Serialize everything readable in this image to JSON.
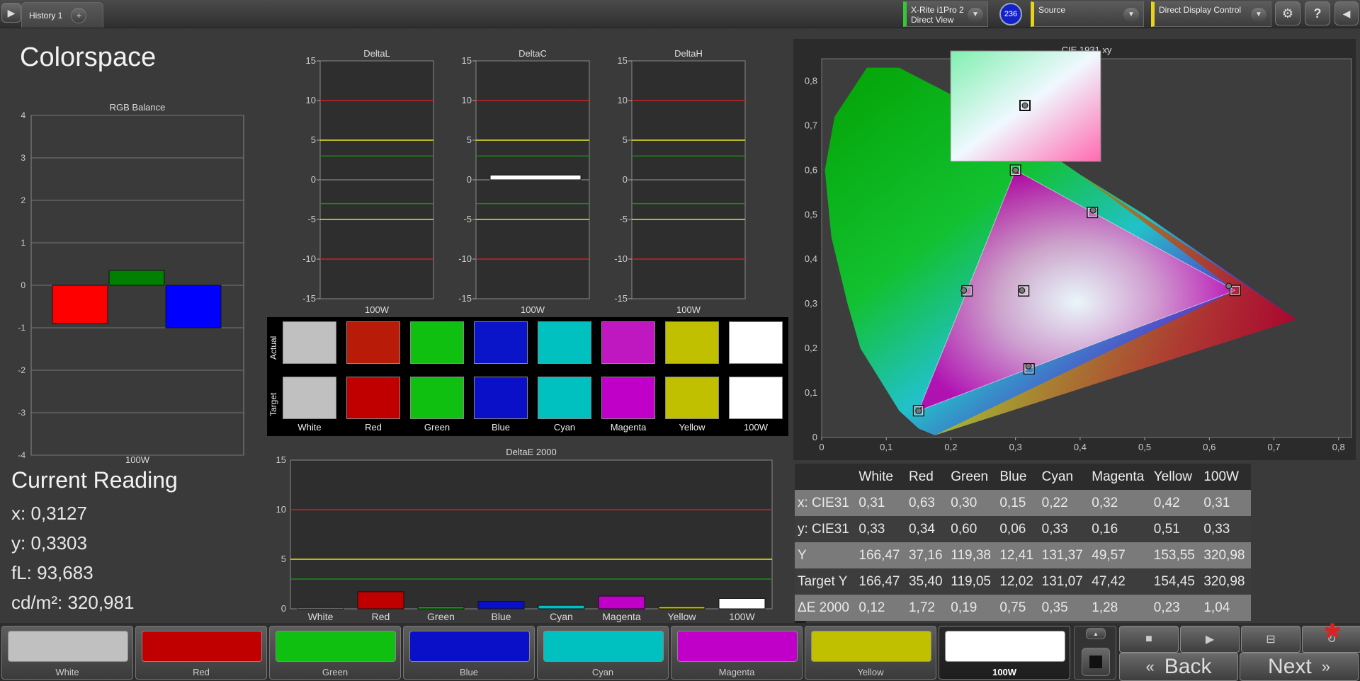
{
  "topbar": {
    "tab_label": "History 1",
    "add_tab": "+",
    "meter_line1": "X-Rite i1Pro 2",
    "meter_line2": "Direct View",
    "meter_badge": "236",
    "source_label": "Source",
    "ddc_label": "Direct Display Control",
    "help_icon_text": "?",
    "colors": {
      "meter": "#39c53a",
      "source": "#e8d31a"
    }
  },
  "page_title": "Colorspace",
  "rgb_balance": {
    "title": "RGB Balance",
    "xlabel": "100W",
    "yticks": [
      "4",
      "3",
      "2",
      "1",
      "0",
      "-1",
      "-2",
      "-3",
      "-4"
    ]
  },
  "delta_charts": [
    {
      "title": "DeltaL",
      "xlabel": "100W"
    },
    {
      "title": "DeltaC",
      "xlabel": "100W"
    },
    {
      "title": "DeltaH",
      "xlabel": "100W"
    }
  ],
  "delta_yticks": [
    "15",
    "10",
    "5",
    "0",
    "-5",
    "-10",
    "-15"
  ],
  "swatches": {
    "actual_label": "Actual",
    "target_label": "Target",
    "names": [
      "White",
      "Red",
      "Green",
      "Blue",
      "Cyan",
      "Magenta",
      "Yellow",
      "100W"
    ],
    "actual_colors": [
      "#c0c0c0",
      "#b81c08",
      "#10c010",
      "#0a14c8",
      "#00c0c0",
      "#c018c0",
      "#c0c000",
      "#ffffff"
    ],
    "target_colors": [
      "#c0c0c0",
      "#c00000",
      "#10c010",
      "#0a10c8",
      "#00c0c0",
      "#c000c8",
      "#c0c000",
      "#ffffff"
    ]
  },
  "deltae": {
    "title": "DeltaE 2000",
    "yticks": [
      "15",
      "10",
      "5",
      "0"
    ],
    "categories": [
      "White",
      "Red",
      "Green",
      "Blue",
      "Cyan",
      "Magenta",
      "Yellow",
      "100W"
    ]
  },
  "cie": {
    "title": "CIE 1931 xy",
    "xticks": [
      "0",
      "0,1",
      "0,2",
      "0,3",
      "0,4",
      "0,5",
      "0,6",
      "0,7",
      "0,8"
    ],
    "yticks": [
      "0,8",
      "0,7",
      "0,6",
      "0,5",
      "0,4",
      "0,3",
      "0,2",
      "0,1",
      "0"
    ]
  },
  "current_reading": {
    "title": "Current Reading",
    "x": "x: 0,3127",
    "y": "y: 0,3303",
    "fl": "fL: 93,683",
    "cdm2": "cd/m²: 320,981"
  },
  "table": {
    "headers": [
      "",
      "White",
      "Red",
      "Green",
      "Blue",
      "Cyan",
      "Magenta",
      "Yellow",
      "100W"
    ],
    "rows": [
      [
        "x: CIE31",
        "0,31",
        "0,63",
        "0,30",
        "0,15",
        "0,22",
        "0,32",
        "0,42",
        "0,31"
      ],
      [
        "y: CIE31",
        "0,33",
        "0,34",
        "0,60",
        "0,06",
        "0,33",
        "0,16",
        "0,51",
        "0,33"
      ],
      [
        "Y",
        "166,47",
        "37,16",
        "119,38",
        "12,41",
        "131,37",
        "49,57",
        "153,55",
        "320,98"
      ],
      [
        "Target Y",
        "166,47",
        "35,40",
        "119,05",
        "12,02",
        "131,07",
        "47,42",
        "154,45",
        "320,98"
      ],
      [
        "ΔE 2000",
        "0,12",
        "1,72",
        "0,19",
        "0,75",
        "0,35",
        "1,28",
        "0,23",
        "1,04"
      ]
    ]
  },
  "bottom": {
    "tiles": [
      {
        "label": "White",
        "color": "#c0c0c0"
      },
      {
        "label": "Red",
        "color": "#c00000"
      },
      {
        "label": "Green",
        "color": "#10c010"
      },
      {
        "label": "Blue",
        "color": "#0a10c8"
      },
      {
        "label": "Cyan",
        "color": "#00c0c0"
      },
      {
        "label": "Magenta",
        "color": "#c000c8"
      },
      {
        "label": "Yellow",
        "color": "#c0c000"
      },
      {
        "label": "100W",
        "color": "#ffffff"
      }
    ],
    "back_label": "Back",
    "next_label": "Next",
    "asterisk": "*"
  },
  "chart_data": [
    {
      "type": "bar",
      "title": "RGB Balance",
      "categories": [
        "100W"
      ],
      "series": [
        {
          "name": "Red",
          "values": [
            -0.9
          ],
          "color": "#ff0000"
        },
        {
          "name": "Green",
          "values": [
            0.35
          ],
          "color": "#008000"
        },
        {
          "name": "Blue",
          "values": [
            -1.0
          ],
          "color": "#0000ff"
        }
      ],
      "ylim": [
        -4,
        4
      ]
    },
    {
      "type": "bar",
      "title": "DeltaL",
      "categories": [
        "100W"
      ],
      "values": [
        0
      ],
      "ylim": [
        -15,
        15
      ]
    },
    {
      "type": "bar",
      "title": "DeltaC",
      "categories": [
        "100W"
      ],
      "values": [
        0.6
      ],
      "ylim": [
        -15,
        15
      ]
    },
    {
      "type": "bar",
      "title": "DeltaH",
      "categories": [
        "100W"
      ],
      "values": [
        0
      ],
      "ylim": [
        -15,
        15
      ]
    },
    {
      "type": "bar",
      "title": "DeltaE 2000",
      "categories": [
        "White",
        "Red",
        "Green",
        "Blue",
        "Cyan",
        "Magenta",
        "Yellow",
        "100W"
      ],
      "values": [
        0.12,
        1.72,
        0.19,
        0.75,
        0.35,
        1.28,
        0.23,
        1.04
      ],
      "colors": [
        "#c0c0c0",
        "#c00000",
        "#10c010",
        "#0a10c8",
        "#00c0c0",
        "#c000c8",
        "#c0c000",
        "#ffffff"
      ],
      "ylim": [
        0,
        15
      ]
    },
    {
      "type": "scatter",
      "title": "CIE 1931 xy",
      "xlim": [
        0,
        0.8
      ],
      "ylim": [
        0,
        0.85
      ],
      "points": [
        {
          "name": "Red target",
          "x": 0.64,
          "y": 0.33
        },
        {
          "name": "Green target",
          "x": 0.3,
          "y": 0.6
        },
        {
          "name": "Blue target",
          "x": 0.15,
          "y": 0.06
        },
        {
          "name": "Cyan target",
          "x": 0.225,
          "y": 0.329
        },
        {
          "name": "Magenta target",
          "x": 0.321,
          "y": 0.154
        },
        {
          "name": "Yellow target",
          "x": 0.419,
          "y": 0.505
        },
        {
          "name": "White target",
          "x": 0.3127,
          "y": 0.329
        }
      ],
      "actual": [
        {
          "name": "Red",
          "x": 0.63,
          "y": 0.34
        },
        {
          "name": "Green",
          "x": 0.3,
          "y": 0.6
        },
        {
          "name": "Blue",
          "x": 0.15,
          "y": 0.06
        },
        {
          "name": "Cyan",
          "x": 0.22,
          "y": 0.33
        },
        {
          "name": "Magenta",
          "x": 0.32,
          "y": 0.16
        },
        {
          "name": "Yellow",
          "x": 0.42,
          "y": 0.51
        },
        {
          "name": "White",
          "x": 0.31,
          "y": 0.33
        }
      ]
    }
  ]
}
